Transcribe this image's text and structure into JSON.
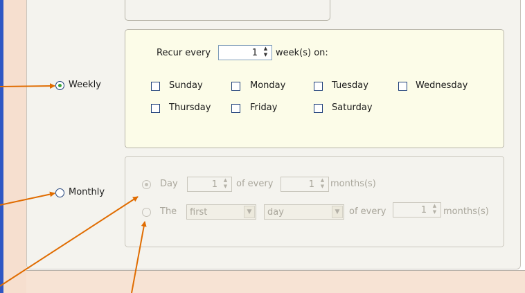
{
  "recurrence": {
    "weekly": {
      "label": "Weekly",
      "recur_every_label": "Recur every",
      "recur_every_value": "1",
      "weeks_on_label": "week(s) on:",
      "days": [
        "Sunday",
        "Monday",
        "Tuesday",
        "Wednesday",
        "Thursday",
        "Friday",
        "Saturday"
      ]
    },
    "monthly": {
      "label": "Monthly",
      "day_option_label": "Day",
      "day_value": "1",
      "of_every_label": "of every",
      "months_value": "1",
      "months_label": "months(s)",
      "the_option_label": "The",
      "ordinal_value": "first",
      "weekday_value": "day",
      "of_every_label_2": "of every",
      "months_value_2": "1",
      "months_label_2": "months(s)"
    }
  },
  "colors": {
    "annotation_arrow": "#e06c00",
    "weekly_box_bg": "#fcfce8",
    "frame_blue": "#2f57c4"
  }
}
